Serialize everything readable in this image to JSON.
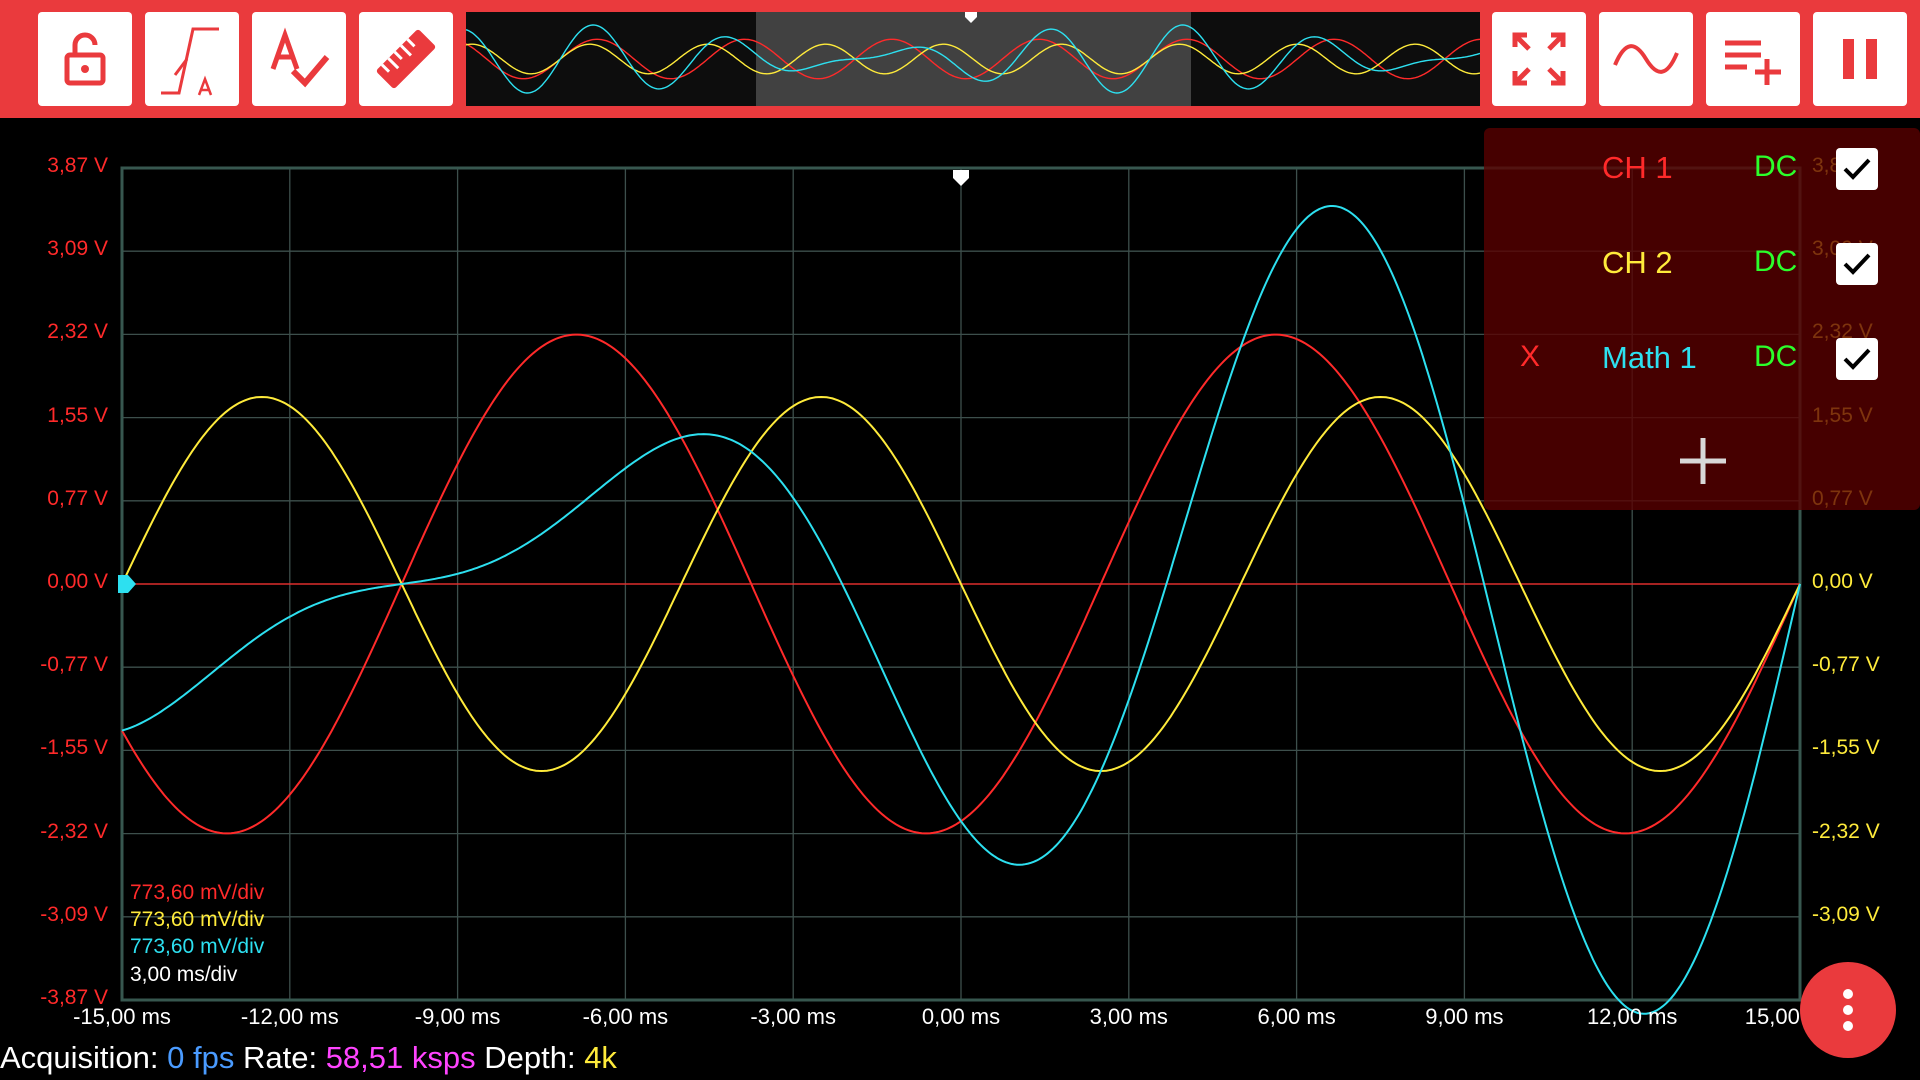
{
  "toolbar": {
    "buttons": [
      {
        "name": "lock-button",
        "icon": "unlock-icon"
      },
      {
        "name": "trigger-button",
        "icon": "trigger-auto-icon"
      },
      {
        "name": "auto-measure-button",
        "icon": "text-check-icon"
      },
      {
        "name": "measure-button",
        "icon": "ruler-icon"
      }
    ],
    "right_buttons": [
      {
        "name": "fit-screen-button",
        "icon": "fullscreen-icon"
      },
      {
        "name": "waveform-button",
        "icon": "sine-wave-icon"
      },
      {
        "name": "add-list-button",
        "icon": "playlist-add-icon"
      },
      {
        "name": "pause-button",
        "icon": "pause-icon"
      }
    ],
    "accent_color": "#ea3a3d"
  },
  "y_labels_left": [
    "3,87 V",
    "3,09 V",
    "2,32 V",
    "1,55 V",
    "0,77 V",
    "0,00 V",
    "-0,77 V",
    "-1,55 V",
    "-2,32 V",
    "-3,09 V",
    "-3,87 V"
  ],
  "y_labels_right": [
    "3,87 V",
    "3,09 V",
    "2,32 V",
    "1,55 V",
    "0,77 V",
    "0,00 V",
    "-0,77 V",
    "-1,55 V",
    "-2,32 V",
    "-3,09 V"
  ],
  "x_labels": [
    "-15,00 ms",
    "-12,00 ms",
    "-9,00 ms",
    "-6,00 ms",
    "-3,00 ms",
    "0,00 ms",
    "3,00 ms",
    "6,00 ms",
    "9,00 ms",
    "12,00 ms",
    "15,00 ms"
  ],
  "scale_labels": [
    {
      "text": "773,60 mV/div",
      "color": "#ff2a2a"
    },
    {
      "text": "773,60 mV/div",
      "color": "#ffeb3b"
    },
    {
      "text": "773,60 mV/div",
      "color": "#2de0f0"
    },
    {
      "text": "3,00 ms/div",
      "color": "#ffffff"
    }
  ],
  "channels": [
    {
      "name": "CH 1",
      "coupling": "DC",
      "color": "#ff2a2a",
      "enabled": true,
      "removable": false
    },
    {
      "name": "CH 2",
      "coupling": "DC",
      "color": "#ffeb3b",
      "enabled": true,
      "removable": false
    },
    {
      "name": "Math 1",
      "coupling": "DC",
      "color": "#2de0f0",
      "enabled": true,
      "removable": true,
      "remove_label": "X"
    }
  ],
  "add_channel_icon": "plus-icon",
  "menu_icon": "more-vert-icon",
  "status": {
    "acq_label": "Acquisition: ",
    "acq_value": "0 fps",
    "rate_label": " Rate: ",
    "rate_value": "58,51 ksps",
    "depth_label": " Depth: ",
    "depth_value": "4k",
    "acq_color": "#4a9bff",
    "rate_color": "#ff44ff",
    "depth_color": "#ffeb3b"
  },
  "chart_data": {
    "type": "line",
    "xlabel": "",
    "ylabel": "",
    "xlim": [
      -15,
      15
    ],
    "ylim": [
      -3.87,
      3.87
    ],
    "x_unit": "ms",
    "y_unit": "V",
    "grid": true,
    "series": [
      {
        "name": "CH 1",
        "color": "#ff2a2a",
        "amplitude": 2.32,
        "period": 12.5,
        "phase_zero_cross_at": -10
      },
      {
        "name": "CH 2",
        "color": "#ffeb3b",
        "amplitude": 1.74,
        "period": 10,
        "phase_zero_cross_at": 0,
        "inverted": true
      },
      {
        "name": "Math 1",
        "color": "#2de0f0",
        "formula": "CH 1 + CH 2"
      }
    ]
  }
}
